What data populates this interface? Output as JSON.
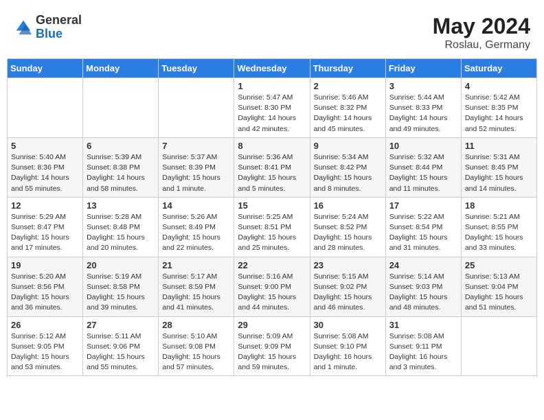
{
  "header": {
    "logo_general": "General",
    "logo_blue": "Blue",
    "month_year": "May 2024",
    "location": "Roslau, Germany"
  },
  "weekdays": [
    "Sunday",
    "Monday",
    "Tuesday",
    "Wednesday",
    "Thursday",
    "Friday",
    "Saturday"
  ],
  "weeks": [
    [
      null,
      null,
      null,
      {
        "day": "1",
        "sunrise": "5:47 AM",
        "sunset": "8:30 PM",
        "daylight": "14 hours and 42 minutes."
      },
      {
        "day": "2",
        "sunrise": "5:46 AM",
        "sunset": "8:32 PM",
        "daylight": "14 hours and 45 minutes."
      },
      {
        "day": "3",
        "sunrise": "5:44 AM",
        "sunset": "8:33 PM",
        "daylight": "14 hours and 49 minutes."
      },
      {
        "day": "4",
        "sunrise": "5:42 AM",
        "sunset": "8:35 PM",
        "daylight": "14 hours and 52 minutes."
      }
    ],
    [
      {
        "day": "5",
        "sunrise": "5:40 AM",
        "sunset": "8:36 PM",
        "daylight": "14 hours and 55 minutes."
      },
      {
        "day": "6",
        "sunrise": "5:39 AM",
        "sunset": "8:38 PM",
        "daylight": "14 hours and 58 minutes."
      },
      {
        "day": "7",
        "sunrise": "5:37 AM",
        "sunset": "8:39 PM",
        "daylight": "15 hours and 1 minute."
      },
      {
        "day": "8",
        "sunrise": "5:36 AM",
        "sunset": "8:41 PM",
        "daylight": "15 hours and 5 minutes."
      },
      {
        "day": "9",
        "sunrise": "5:34 AM",
        "sunset": "8:42 PM",
        "daylight": "15 hours and 8 minutes."
      },
      {
        "day": "10",
        "sunrise": "5:32 AM",
        "sunset": "8:44 PM",
        "daylight": "15 hours and 11 minutes."
      },
      {
        "day": "11",
        "sunrise": "5:31 AM",
        "sunset": "8:45 PM",
        "daylight": "15 hours and 14 minutes."
      }
    ],
    [
      {
        "day": "12",
        "sunrise": "5:29 AM",
        "sunset": "8:47 PM",
        "daylight": "15 hours and 17 minutes."
      },
      {
        "day": "13",
        "sunrise": "5:28 AM",
        "sunset": "8:48 PM",
        "daylight": "15 hours and 20 minutes."
      },
      {
        "day": "14",
        "sunrise": "5:26 AM",
        "sunset": "8:49 PM",
        "daylight": "15 hours and 22 minutes."
      },
      {
        "day": "15",
        "sunrise": "5:25 AM",
        "sunset": "8:51 PM",
        "daylight": "15 hours and 25 minutes."
      },
      {
        "day": "16",
        "sunrise": "5:24 AM",
        "sunset": "8:52 PM",
        "daylight": "15 hours and 28 minutes."
      },
      {
        "day": "17",
        "sunrise": "5:22 AM",
        "sunset": "8:54 PM",
        "daylight": "15 hours and 31 minutes."
      },
      {
        "day": "18",
        "sunrise": "5:21 AM",
        "sunset": "8:55 PM",
        "daylight": "15 hours and 33 minutes."
      }
    ],
    [
      {
        "day": "19",
        "sunrise": "5:20 AM",
        "sunset": "8:56 PM",
        "daylight": "15 hours and 36 minutes."
      },
      {
        "day": "20",
        "sunrise": "5:19 AM",
        "sunset": "8:58 PM",
        "daylight": "15 hours and 39 minutes."
      },
      {
        "day": "21",
        "sunrise": "5:17 AM",
        "sunset": "8:59 PM",
        "daylight": "15 hours and 41 minutes."
      },
      {
        "day": "22",
        "sunrise": "5:16 AM",
        "sunset": "9:00 PM",
        "daylight": "15 hours and 44 minutes."
      },
      {
        "day": "23",
        "sunrise": "5:15 AM",
        "sunset": "9:02 PM",
        "daylight": "15 hours and 46 minutes."
      },
      {
        "day": "24",
        "sunrise": "5:14 AM",
        "sunset": "9:03 PM",
        "daylight": "15 hours and 48 minutes."
      },
      {
        "day": "25",
        "sunrise": "5:13 AM",
        "sunset": "9:04 PM",
        "daylight": "15 hours and 51 minutes."
      }
    ],
    [
      {
        "day": "26",
        "sunrise": "5:12 AM",
        "sunset": "9:05 PM",
        "daylight": "15 hours and 53 minutes."
      },
      {
        "day": "27",
        "sunrise": "5:11 AM",
        "sunset": "9:06 PM",
        "daylight": "15 hours and 55 minutes."
      },
      {
        "day": "28",
        "sunrise": "5:10 AM",
        "sunset": "9:08 PM",
        "daylight": "15 hours and 57 minutes."
      },
      {
        "day": "29",
        "sunrise": "5:09 AM",
        "sunset": "9:09 PM",
        "daylight": "15 hours and 59 minutes."
      },
      {
        "day": "30",
        "sunrise": "5:08 AM",
        "sunset": "9:10 PM",
        "daylight": "16 hours and 1 minute."
      },
      {
        "day": "31",
        "sunrise": "5:08 AM",
        "sunset": "9:11 PM",
        "daylight": "16 hours and 3 minutes."
      },
      null
    ]
  ]
}
